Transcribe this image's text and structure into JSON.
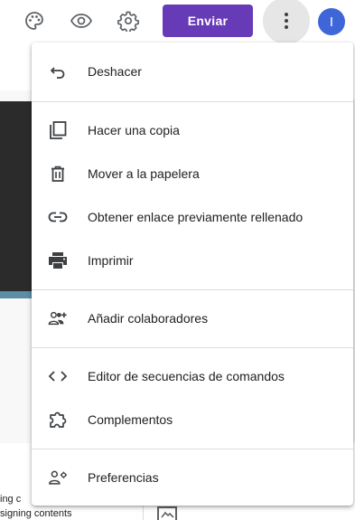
{
  "toolbar": {
    "send_label": "Enviar",
    "avatar_initial": "I",
    "icons": [
      "palette-icon",
      "eye-icon",
      "gear-icon",
      "more-vert-icon"
    ],
    "accent_color": "#673ab7"
  },
  "menu": {
    "items": [
      {
        "label": "Deshacer",
        "icon": "undo-icon"
      },
      {
        "label": "Hacer una copia",
        "icon": "copy-icon"
      },
      {
        "label": "Mover a la papelera",
        "icon": "trash-icon"
      },
      {
        "label": "Obtener enlace previamente rellenado",
        "icon": "link-icon"
      },
      {
        "label": "Imprimir",
        "icon": "print-icon"
      },
      {
        "label": "Añadir colaboradores",
        "icon": "add-people-icon"
      },
      {
        "label": "Editor de secuencias de comandos",
        "icon": "code-icon"
      },
      {
        "label": "Complementos",
        "icon": "puzzle-icon"
      },
      {
        "label": "Preferencias",
        "icon": "user-settings-icon"
      }
    ]
  },
  "background": {
    "text_line_1": "ing c",
    "text_line_2": "signing contents"
  }
}
